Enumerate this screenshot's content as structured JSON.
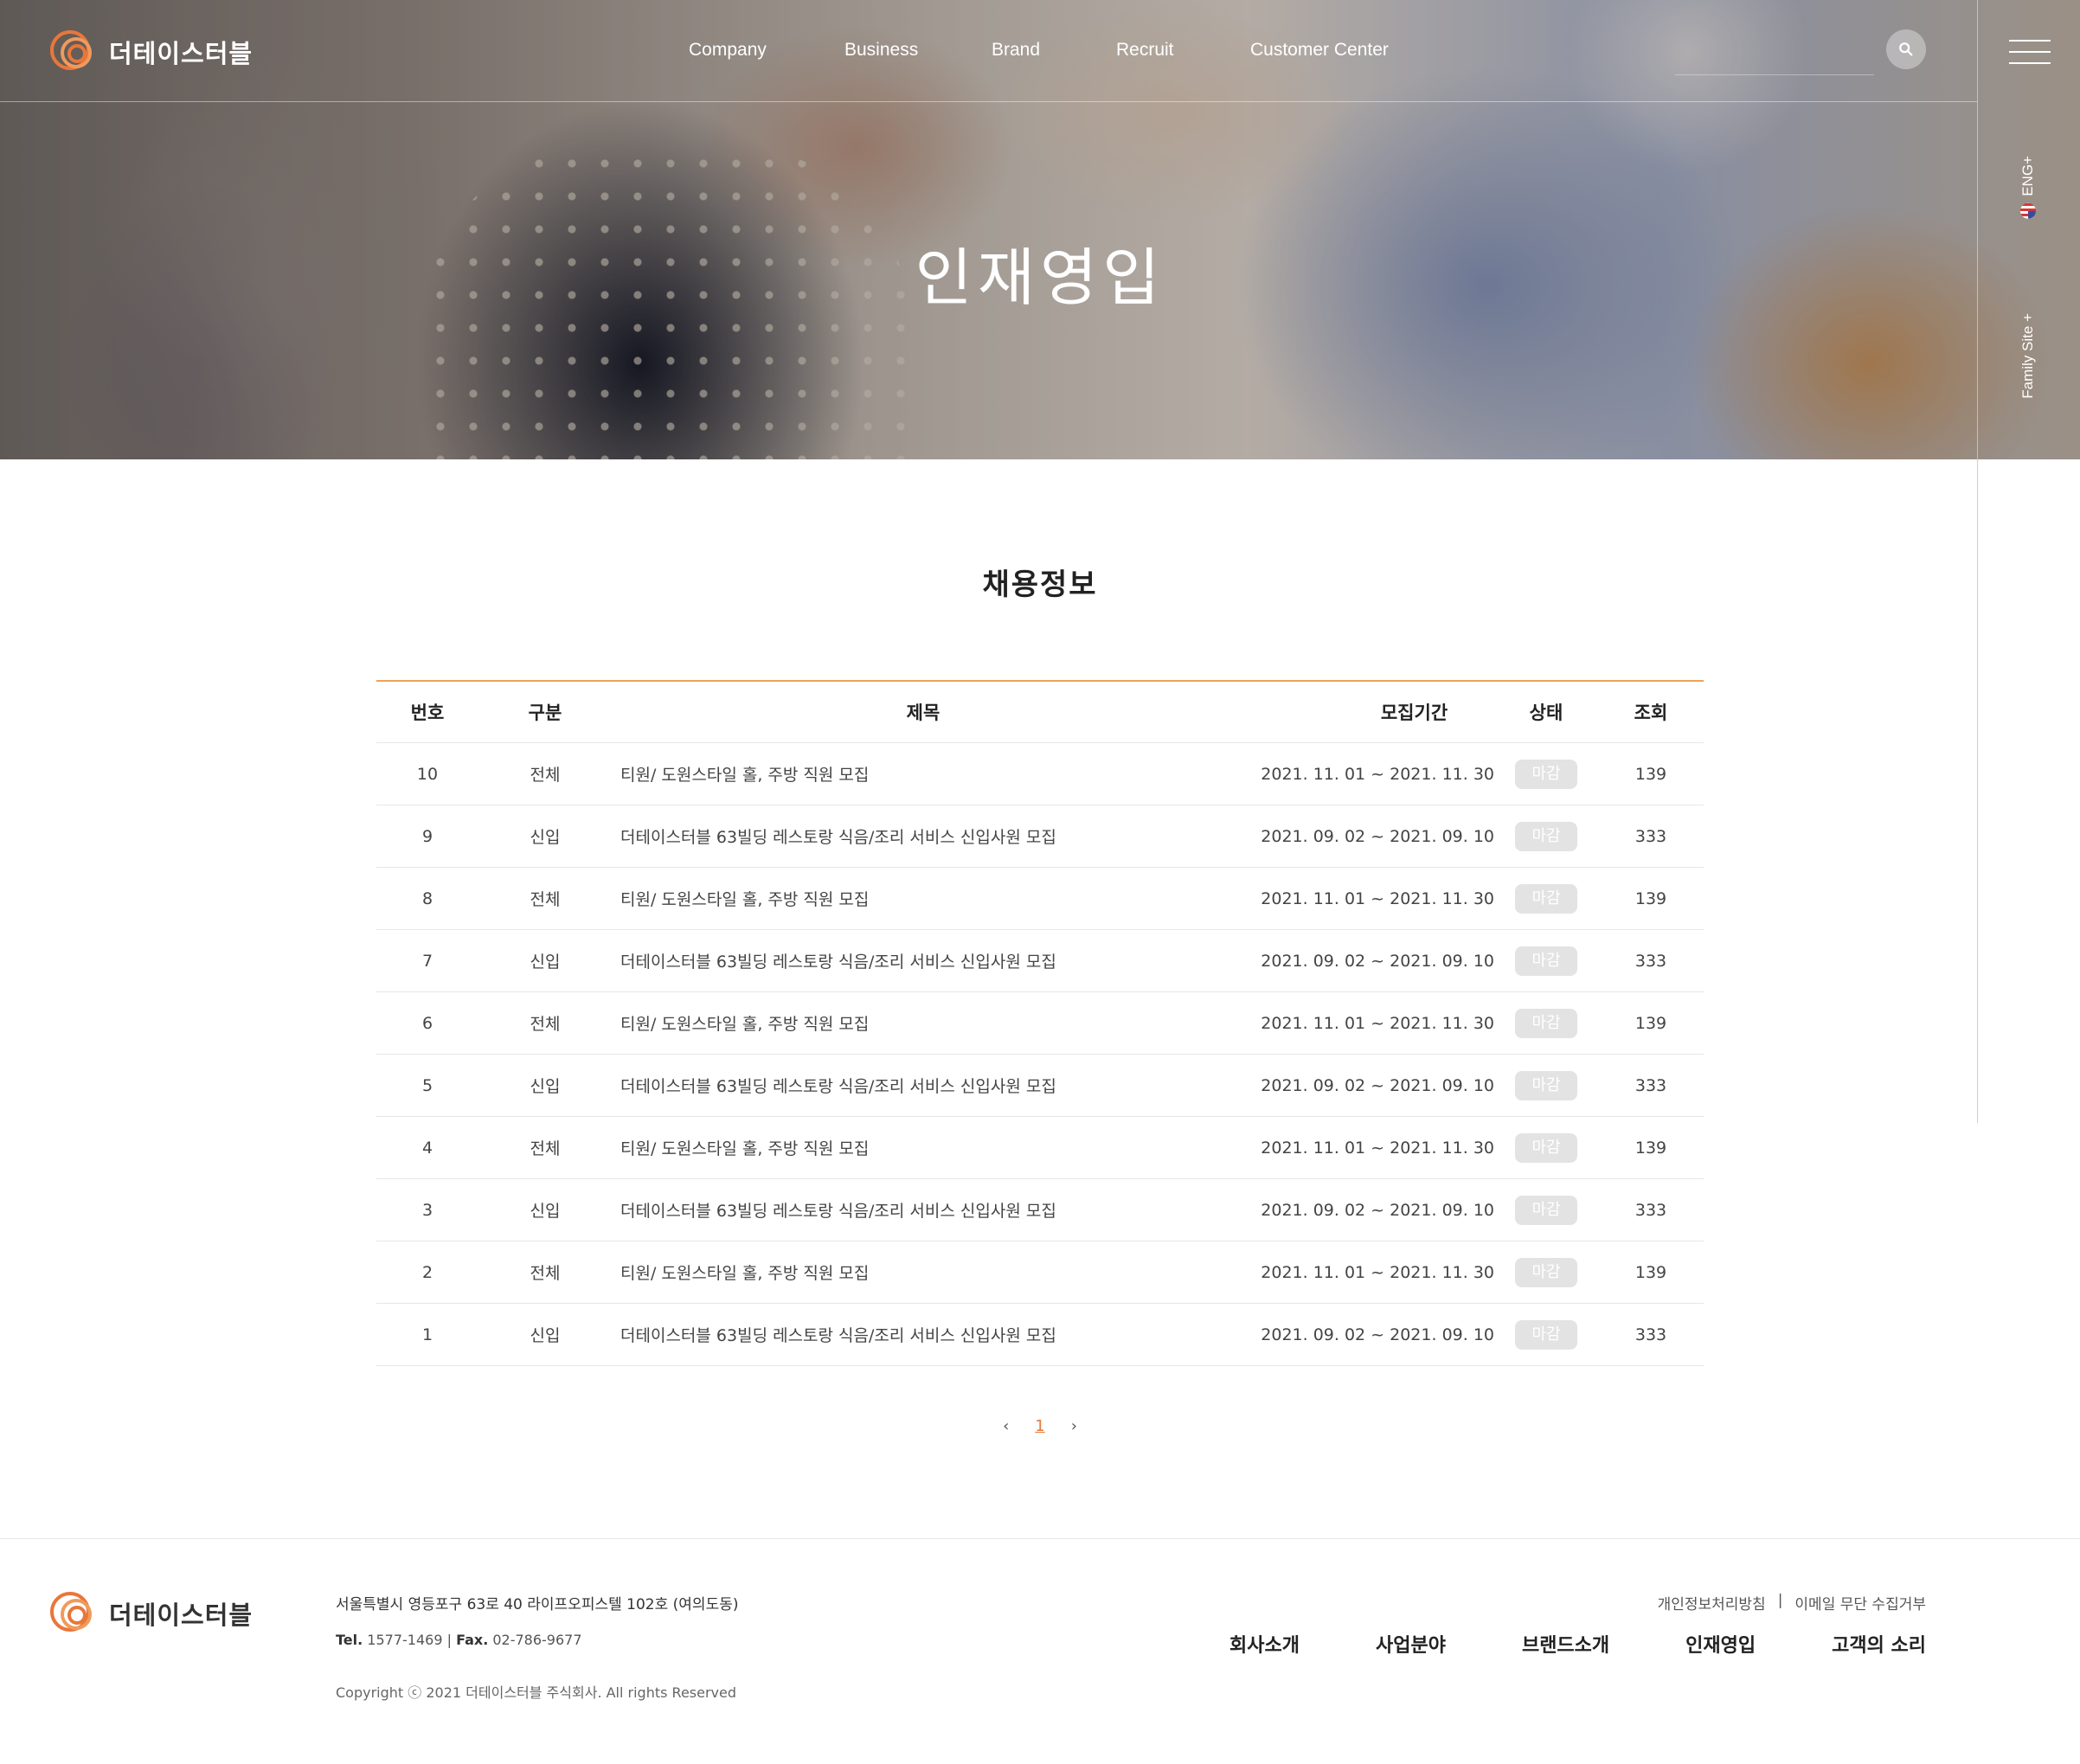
{
  "header": {
    "logo_text": "더테이스터블",
    "nav": [
      {
        "label": "Company"
      },
      {
        "label": "Business"
      },
      {
        "label": "Brand"
      },
      {
        "label": "Recruit"
      },
      {
        "label": "Customer Center"
      }
    ],
    "lang_label": "ENG+",
    "family_site_label": "Family Site +"
  },
  "hero": {
    "title": "인재영입"
  },
  "main": {
    "section_title": "채용정보",
    "columns": [
      "번호",
      "구분",
      "제목",
      "모집기간",
      "상태",
      "조회"
    ],
    "rows": [
      {
        "no": "10",
        "category": "전체",
        "title": "티원/ 도원스타일 홀, 주방 직원 모집",
        "period": "2021. 11. 01 ~ 2021. 11. 30",
        "status": "마감",
        "views": "139"
      },
      {
        "no": "9",
        "category": "신입",
        "title": "더테이스터블 63빌딩 레스토랑 식음/조리 서비스 신입사원 모집",
        "period": "2021. 09. 02 ~ 2021. 09. 10",
        "status": "마감",
        "views": "333"
      },
      {
        "no": "8",
        "category": "전체",
        "title": "티원/ 도원스타일 홀, 주방 직원 모집",
        "period": "2021. 11. 01 ~ 2021. 11. 30",
        "status": "마감",
        "views": "139"
      },
      {
        "no": "7",
        "category": "신입",
        "title": "더테이스터블 63빌딩 레스토랑 식음/조리 서비스 신입사원 모집",
        "period": "2021. 09. 02 ~ 2021. 09. 10",
        "status": "마감",
        "views": "333"
      },
      {
        "no": "6",
        "category": "전체",
        "title": "티원/ 도원스타일 홀, 주방 직원 모집",
        "period": "2021. 11. 01 ~ 2021. 11. 30",
        "status": "마감",
        "views": "139"
      },
      {
        "no": "5",
        "category": "신입",
        "title": "더테이스터블 63빌딩 레스토랑 식음/조리 서비스 신입사원 모집",
        "period": "2021. 09. 02 ~ 2021. 09. 10",
        "status": "마감",
        "views": "333"
      },
      {
        "no": "4",
        "category": "전체",
        "title": "티원/ 도원스타일 홀, 주방 직원 모집",
        "period": "2021. 11. 01 ~ 2021. 11. 30",
        "status": "마감",
        "views": "139"
      },
      {
        "no": "3",
        "category": "신입",
        "title": "더테이스터블 63빌딩 레스토랑 식음/조리 서비스 신입사원 모집",
        "period": "2021. 09. 02 ~ 2021. 09. 10",
        "status": "마감",
        "views": "333"
      },
      {
        "no": "2",
        "category": "전체",
        "title": "티원/ 도원스타일 홀, 주방 직원 모집",
        "period": "2021. 11. 01 ~ 2021. 11. 30",
        "status": "마감",
        "views": "139"
      },
      {
        "no": "1",
        "category": "신입",
        "title": "더테이스터블 63빌딩 레스토랑 식음/조리 서비스 신입사원 모집",
        "period": "2021. 09. 02 ~ 2021. 09. 10",
        "status": "마감",
        "views": "333"
      }
    ],
    "pagination": {
      "prev": "‹",
      "current": "1",
      "next": "›"
    }
  },
  "footer": {
    "logo_text": "더테이스터블",
    "address": "서울특별시 영등포구 63로 40 라이프오피스텔 102호 (여의도동)",
    "tel_label": "Tel.",
    "tel": "1577-1469",
    "fax_label": "Fax.",
    "fax": "02-786-9677",
    "copyright": "Copyright ⓒ 2021 더테이스터블 주식회사. All rights Reserved",
    "policy_links": [
      "개인정보처리방침",
      "이메일 무단 수집거부"
    ],
    "policy_separator": "|",
    "nav": [
      "회사소개",
      "사업분야",
      "브랜드소개",
      "인재영입",
      "고객의 소리"
    ]
  },
  "colors": {
    "accent": "#e8773a",
    "table_top_border": "#e9a458",
    "badge_bg": "#e3e3e3"
  },
  "icons": [
    "logo-mark-icon",
    "search-icon",
    "hamburger-icon",
    "us-flag-icon"
  ]
}
